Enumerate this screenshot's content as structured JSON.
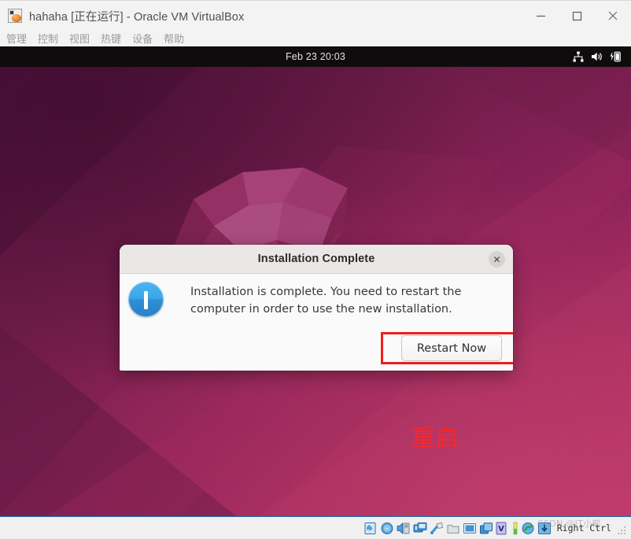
{
  "window": {
    "title": "hahaha [正在运行] - Oracle VM VirtualBox",
    "app_icon": "virtualbox-icon",
    "controls": {
      "minimize_label": "—",
      "maximize_label": "□",
      "close_label": "✕"
    }
  },
  "menubar": {
    "items": [
      {
        "label": "管理"
      },
      {
        "label": "控制"
      },
      {
        "label": "视图"
      },
      {
        "label": "热键"
      },
      {
        "label": "设备"
      },
      {
        "label": "帮助"
      }
    ]
  },
  "guest": {
    "topbar": {
      "clock": "Feb 23  20:03",
      "indicators": [
        "network-wired-icon",
        "volume-icon",
        "battery-charging-icon"
      ]
    },
    "wallpaper": {
      "name": "ubuntu-focal-fossa-wallpaper",
      "base_color": "#8d2259",
      "accent_color": "#b8356a"
    },
    "annotation": {
      "text": "重启",
      "color": "#fc2626"
    }
  },
  "dialog": {
    "title": "Installation Complete",
    "close_label": "✕",
    "icon": "info-icon",
    "message": "Installation is complete. You need to restart the computer in order to use the new installation.",
    "primary_button": "Restart Now",
    "highlight_color": "#f01c1c"
  },
  "statusbar": {
    "icons": [
      "hard-disk-icon",
      "optical-disk-icon",
      "audio-icon",
      "network-icon",
      "usb-icon",
      "shared-folder-icon",
      "display-icon",
      "shared-clipboard-icon",
      "virtualbox-logo-icon",
      "activity-indicator-icon",
      "globe-icon",
      "mouse-capture-icon"
    ],
    "host_key": "Right Ctrl"
  },
  "overlay": {
    "watermark": "CSDN @IT小郁"
  }
}
